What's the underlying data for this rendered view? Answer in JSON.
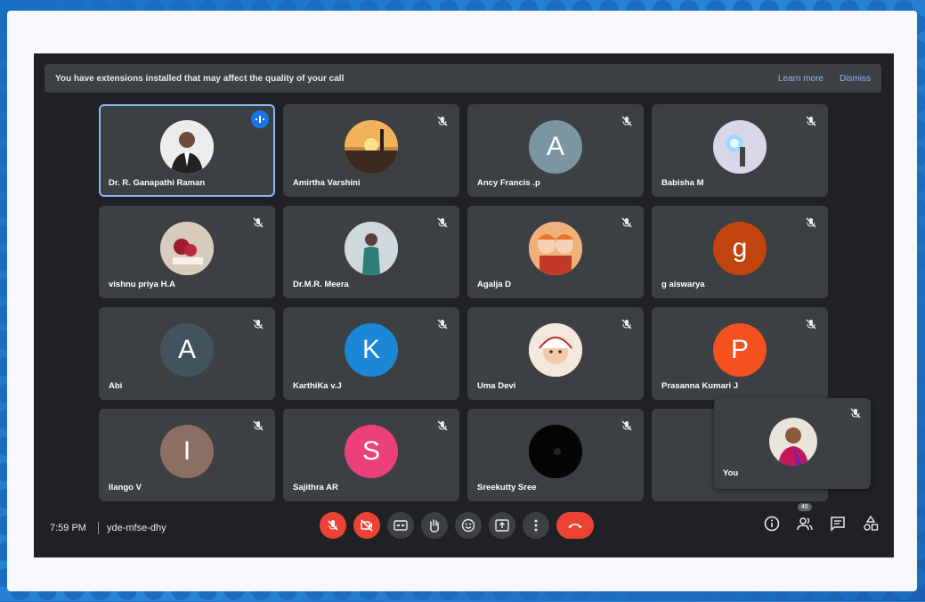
{
  "banner": {
    "message": "You have extensions installed that may affect the quality of your call",
    "learn_more": "Learn more",
    "dismiss": "Dismiss"
  },
  "participants": [
    {
      "name": "Dr. R. Ganapathi Raman",
      "avatar": "photo-man-suit",
      "letter": "",
      "color": "#d9d4cf",
      "speaking": true
    },
    {
      "name": "Amirtha Varshini",
      "avatar": "photo-sunset",
      "letter": "",
      "color": "#c98a3a",
      "speaking": false
    },
    {
      "name": "Ancy Francis .p",
      "avatar": "letter",
      "letter": "A",
      "color": "#7b95a3",
      "speaking": false
    },
    {
      "name": "Babisha M",
      "avatar": "photo-light",
      "letter": "",
      "color": "#6a8bc7",
      "speaking": false
    },
    {
      "name": "vishnu priya H.A",
      "avatar": "photo-roses",
      "letter": "",
      "color": "#c9b8a8",
      "speaking": false
    },
    {
      "name": "Dr.M.R. Meera",
      "avatar": "photo-woman",
      "letter": "",
      "color": "#b9c3c7",
      "speaking": false
    },
    {
      "name": "Agalja D",
      "avatar": "photo-dolls",
      "letter": "",
      "color": "#e39a5a",
      "speaking": false
    },
    {
      "name": "g aiswarya",
      "avatar": "letter",
      "letter": "g",
      "color": "#c1440e",
      "speaking": false
    },
    {
      "name": "Abi",
      "avatar": "letter",
      "letter": "A",
      "color": "#42535e",
      "speaking": false
    },
    {
      "name": "KarthiKa v.J",
      "avatar": "letter",
      "letter": "K",
      "color": "#1a88d6",
      "speaking": false
    },
    {
      "name": "Uma Devi",
      "avatar": "photo-baby",
      "letter": "",
      "color": "#e8c9b0",
      "speaking": false
    },
    {
      "name": "Prasanna Kumari J",
      "avatar": "letter",
      "letter": "P",
      "color": "#f4511e",
      "speaking": false
    },
    {
      "name": "Ilango V",
      "avatar": "letter",
      "letter": "I",
      "color": "#8d6e63",
      "speaking": false
    },
    {
      "name": "Sajithra AR",
      "avatar": "letter",
      "letter": "S",
      "color": "#ec407a",
      "speaking": false
    },
    {
      "name": "Sreekutty Sree",
      "avatar": "photo-dark",
      "letter": "",
      "color": "#0b0b0b",
      "speaking": false
    },
    {
      "name": "",
      "avatar": "hidden",
      "letter": "",
      "color": "#3c4043",
      "speaking": false
    }
  ],
  "self_view": {
    "name": "You",
    "avatar": "photo-woman-saree"
  },
  "bottom_bar": {
    "time": "7:59 PM",
    "meeting_code": "yde-mfse-dhy",
    "people_count": "46"
  },
  "controls": [
    "mic-off-icon",
    "camera-off-icon",
    "captions-icon",
    "raise-hand-icon",
    "emoji-icon",
    "present-icon",
    "more-icon",
    "hang-up-icon"
  ],
  "accent": "#8ab4f8",
  "danger": "#ea4335"
}
